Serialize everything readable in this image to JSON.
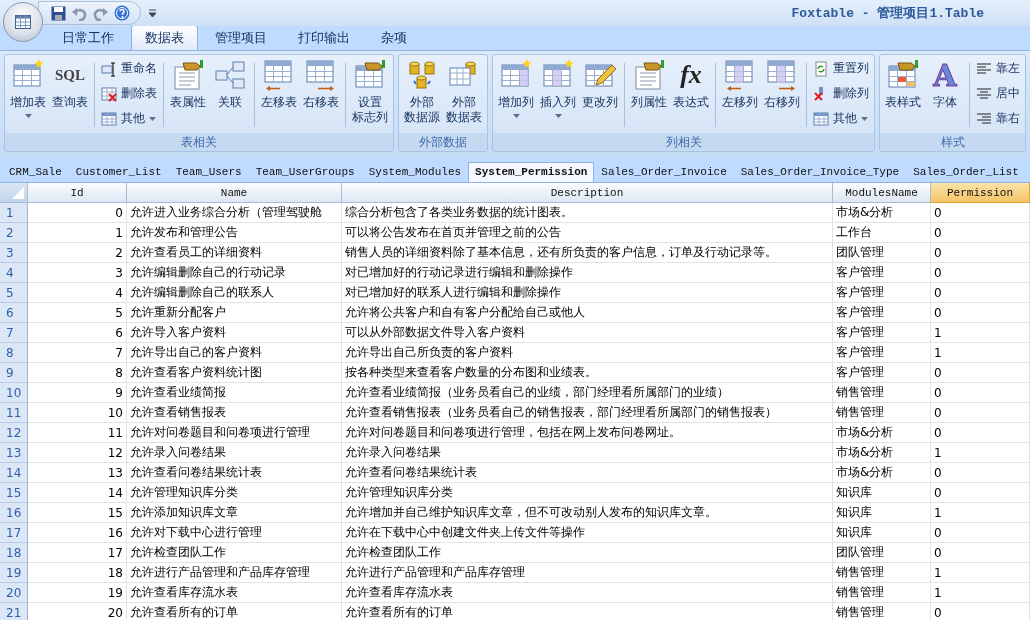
{
  "window": {
    "title": "Foxtable - 管理项目1.Table"
  },
  "menu_tabs": [
    {
      "label": "日常工作",
      "selected": false
    },
    {
      "label": "数据表",
      "selected": true
    },
    {
      "label": "管理项目",
      "selected": false
    },
    {
      "label": "打印输出",
      "selected": false
    },
    {
      "label": "杂项",
      "selected": false
    }
  ],
  "ribbon_groups": [
    {
      "title": "表相关",
      "items": [
        {
          "kind": "large",
          "label": "增加表",
          "dropdown": true
        },
        {
          "kind": "large",
          "label": "查询表",
          "dropdown": false,
          "icon_text": "SQL"
        },
        {
          "kind": "separator"
        },
        {
          "kind": "stack",
          "buttons": [
            {
              "label": "重命名",
              "dropdown": false
            },
            {
              "label": "删除表",
              "dropdown": false
            },
            {
              "label": "其他",
              "dropdown": true
            }
          ]
        },
        {
          "kind": "separator"
        },
        {
          "kind": "large",
          "label": "表属性",
          "dropdown": false
        },
        {
          "kind": "large",
          "label": "关联",
          "dropdown": false
        },
        {
          "kind": "separator"
        },
        {
          "kind": "large",
          "label": "左移表",
          "dropdown": false
        },
        {
          "kind": "large",
          "label": "右移表",
          "dropdown": false
        },
        {
          "kind": "separator"
        },
        {
          "kind": "large",
          "label": "设置标志列",
          "dropdown": false
        }
      ]
    },
    {
      "title": "外部数据",
      "items": [
        {
          "kind": "large",
          "label": "外部数据源",
          "dropdown": false
        },
        {
          "kind": "large",
          "label": "外部数据表",
          "dropdown": false
        }
      ]
    },
    {
      "title": "列相关",
      "items": [
        {
          "kind": "large",
          "label": "增加列",
          "dropdown": true
        },
        {
          "kind": "large",
          "label": "插入列",
          "dropdown": true
        },
        {
          "kind": "large",
          "label": "更改列",
          "dropdown": false
        },
        {
          "kind": "separator"
        },
        {
          "kind": "large",
          "label": "列属性",
          "dropdown": false
        },
        {
          "kind": "large",
          "label": "表达式",
          "dropdown": false,
          "icon_text": "fx"
        },
        {
          "kind": "separator"
        },
        {
          "kind": "large",
          "label": "左移列",
          "dropdown": false
        },
        {
          "kind": "large",
          "label": "右移列",
          "dropdown": false
        },
        {
          "kind": "separator"
        },
        {
          "kind": "stack",
          "buttons": [
            {
              "label": "重置列",
              "dropdown": false
            },
            {
              "label": "删除列",
              "dropdown": false
            },
            {
              "label": "其他",
              "dropdown": true
            }
          ]
        }
      ]
    },
    {
      "title": "样式",
      "items": [
        {
          "kind": "large",
          "label": "表样式",
          "dropdown": false
        },
        {
          "kind": "large",
          "label": "字体",
          "dropdown": false,
          "icon_text": "A"
        },
        {
          "kind": "separator"
        },
        {
          "kind": "stack",
          "buttons": [
            {
              "label": "靠左",
              "dropdown": false
            },
            {
              "label": "居中",
              "dropdown": false
            },
            {
              "label": "靠右",
              "dropdown": false
            }
          ]
        }
      ]
    }
  ],
  "sheet_tabs": [
    {
      "label": "CRM_Sale",
      "selected": false
    },
    {
      "label": "Customer_List",
      "selected": false
    },
    {
      "label": "Team_Users",
      "selected": false
    },
    {
      "label": "Team_UserGroups",
      "selected": false
    },
    {
      "label": "System_Modules",
      "selected": false
    },
    {
      "label": "System_Permission",
      "selected": true
    },
    {
      "label": "Sales_Order_Invoice",
      "selected": false
    },
    {
      "label": "Sales_Order_Invoice_Type",
      "selected": false
    },
    {
      "label": "Sales_Order_List",
      "selected": false
    }
  ],
  "table": {
    "columns": [
      {
        "label": "Id",
        "selected": false
      },
      {
        "label": "Name",
        "selected": false
      },
      {
        "label": "Description",
        "selected": false
      },
      {
        "label": "ModulesName",
        "selected": false
      },
      {
        "label": "Permission",
        "selected": true
      }
    ],
    "rows": [
      {
        "number": "1",
        "cells": [
          "0",
          "允许进入业务综合分析（管理驾驶舱",
          "综合分析包含了各类业务数据的统计图表。",
          "市场&分析",
          "0"
        ]
      },
      {
        "number": "2",
        "cells": [
          "1",
          "允许发布和管理公告",
          "可以将公告发布在首页并管理之前的公告",
          "工作台",
          "0"
        ]
      },
      {
        "number": "3",
        "cells": [
          "2",
          "允许查看员工的详细资料",
          "销售人员的详细资料除了基本信息，还有所负责的客户信息，订单及行动记录等。",
          "团队管理",
          "0"
        ]
      },
      {
        "number": "4",
        "cells": [
          "3",
          "允许编辑删除自己的行动记录",
          "对已增加好的行动记录进行编辑和删除操作",
          "客户管理",
          "0"
        ]
      },
      {
        "number": "5",
        "cells": [
          "4",
          "允许编辑删除自己的联系人",
          "对已增加好的联系人进行编辑和删除操作",
          "客户管理",
          "0"
        ]
      },
      {
        "number": "6",
        "cells": [
          "5",
          "允许重新分配客户",
          "允许将公共客户和自有客户分配给自己或他人",
          "客户管理",
          "0"
        ]
      },
      {
        "number": "7",
        "cells": [
          "6",
          "允许导入客户资料",
          "可以从外部数据文件导入客户资料",
          "客户管理",
          "1"
        ]
      },
      {
        "number": "8",
        "cells": [
          "7",
          "允许导出自己的客户资料",
          "允许导出自己所负责的客户资料",
          "客户管理",
          "1"
        ]
      },
      {
        "number": "9",
        "cells": [
          "8",
          "允许查看客户资料统计图",
          "按各种类型来查看客户数量的分布图和业绩表。",
          "客户管理",
          "0"
        ]
      },
      {
        "number": "10",
        "cells": [
          "9",
          "允许查看业绩简报",
          "允许查看业绩简报（业务员看自己的业绩，部门经理看所属部门的业绩）",
          "销售管理",
          "0"
        ]
      },
      {
        "number": "11",
        "cells": [
          "10",
          "允许查看销售报表",
          "允许查看销售报表（业务员看自己的销售报表，部门经理看所属部门的销售报表）",
          "销售管理",
          "0"
        ]
      },
      {
        "number": "12",
        "cells": [
          "11",
          "允许对问卷题目和问卷项进行管理",
          "允许对问卷题目和问卷项进行管理，包括在网上发布问卷网址。",
          "市场&分析",
          "0"
        ]
      },
      {
        "number": "13",
        "cells": [
          "12",
          "允许录入问卷结果",
          "允许录入问卷结果",
          "市场&分析",
          "1"
        ]
      },
      {
        "number": "14",
        "cells": [
          "13",
          "允许查看问卷结果统计表",
          "允许查看问卷结果统计表",
          "市场&分析",
          "0"
        ]
      },
      {
        "number": "15",
        "cells": [
          "14",
          "允许管理知识库分类",
          "允许管理知识库分类",
          "知识库",
          "0"
        ]
      },
      {
        "number": "16",
        "cells": [
          "15",
          "允许添加知识库文章",
          "允许增加并自己维护知识库文章，但不可改动别人发布的知识库文章。",
          "知识库",
          "1"
        ]
      },
      {
        "number": "17",
        "cells": [
          "16",
          "允许对下载中心进行管理",
          "允许在下载中心中创建文件夹上传文件等操作",
          "知识库",
          "0"
        ]
      },
      {
        "number": "18",
        "cells": [
          "17",
          "允许检查团队工作",
          "允许检查团队工作",
          "团队管理",
          "0"
        ]
      },
      {
        "number": "19",
        "cells": [
          "18",
          "允许进行产品管理和产品库存管理",
          "允许进行产品管理和产品库存管理",
          "销售管理",
          "1"
        ]
      },
      {
        "number": "20",
        "cells": [
          "19",
          "允许查看库存流水表",
          "允许查看库存流水表",
          "销售管理",
          "1"
        ]
      },
      {
        "number": "21",
        "cells": [
          "20",
          "允许查看所有的订单",
          "允许查看所有的订单",
          "销售管理",
          "0"
        ]
      }
    ]
  }
}
